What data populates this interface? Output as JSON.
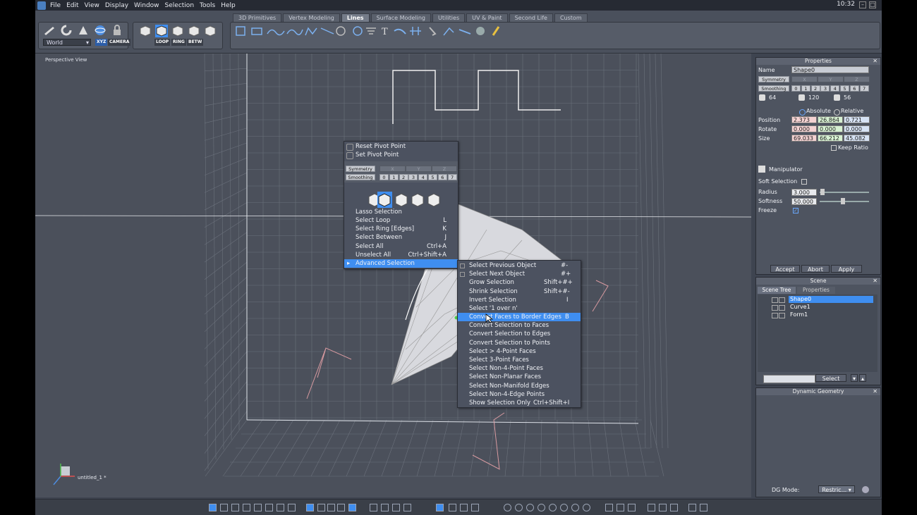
{
  "menubar": {
    "items": [
      "File",
      "Edit",
      "View",
      "Display",
      "Window",
      "Selection",
      "Tools",
      "Help"
    ],
    "clock": "10:32"
  },
  "toolbar": {
    "tabs": [
      "3D Primitives",
      "Vertex Modeling",
      "Lines",
      "Surface Modeling",
      "Utilities",
      "UV & Paint",
      "Second Life",
      "Custom"
    ],
    "active_tab": "Lines",
    "coord_system": "World",
    "xyz_label": "XYZ",
    "camera_label": "CAMERA",
    "loop_label": "LOOP",
    "ring_label": "RING",
    "betw_label": "BETW"
  },
  "viewport": {
    "title": "Perspective View",
    "file_label": "untitled_1 *"
  },
  "context_menu": {
    "pivot_items": [
      "Reset Pivot Point",
      "Set Pivot Point"
    ],
    "symmetry_label": "Symmetry",
    "smoothing_label": "Smoothing",
    "axes": [
      "X",
      "Y",
      "Z"
    ],
    "levels": [
      "0",
      "1",
      "2",
      "3",
      "4",
      "5",
      "6",
      "7"
    ],
    "items": [
      {
        "label": "Lasso Selection",
        "shortcut": ""
      },
      {
        "label": "Select Loop",
        "shortcut": "L"
      },
      {
        "label": "Select Ring [Edges]",
        "shortcut": "K"
      },
      {
        "label": "Select Between",
        "shortcut": "J"
      },
      {
        "label": "Select All",
        "shortcut": "Ctrl+A"
      },
      {
        "label": "Unselect All",
        "shortcut": "Ctrl+Shift+A"
      },
      {
        "label": "Advanced Selection",
        "shortcut": ""
      }
    ]
  },
  "submenu": {
    "items": [
      {
        "label": "Select Previous Object",
        "shortcut": "#-"
      },
      {
        "label": "Select Next Object",
        "shortcut": "#+"
      },
      {
        "label": "Grow Selection",
        "shortcut": "Shift+#+"
      },
      {
        "label": "Shrink Selection",
        "shortcut": "Shift+#-"
      },
      {
        "label": "Invert Selection",
        "shortcut": "I"
      },
      {
        "label": "Select '1 over n'",
        "shortcut": ""
      },
      {
        "label": "Convert Faces to Border Edges",
        "shortcut": "B"
      },
      {
        "label": "Convert Selection to Faces",
        "shortcut": ""
      },
      {
        "label": "Convert Selection to Edges",
        "shortcut": ""
      },
      {
        "label": "Convert Selection to Points",
        "shortcut": ""
      },
      {
        "label": "Select > 4-Point Faces",
        "shortcut": ""
      },
      {
        "label": "Select 3-Point Faces",
        "shortcut": ""
      },
      {
        "label": "Select Non-4-Point Faces",
        "shortcut": ""
      },
      {
        "label": "Select Non-Planar Faces",
        "shortcut": ""
      },
      {
        "label": "Select Non-Manifold Edges",
        "shortcut": ""
      },
      {
        "label": "Select Non-4-Edge Points",
        "shortcut": ""
      },
      {
        "label": "Show Selection Only",
        "shortcut": "Ctrl+Shift+I"
      }
    ]
  },
  "properties": {
    "title": "Properties",
    "name_label": "Name",
    "name_value": "Shape0",
    "symmetry_label": "Symmetry",
    "smoothing_label": "Smoothing",
    "stats": [
      "64",
      "120",
      "56"
    ],
    "absolute_label": "Absolute",
    "relative_label": "Relative",
    "position_label": "Position",
    "rotate_label": "Rotate",
    "size_label": "Size",
    "position": [
      "2.373",
      "26.864",
      "0.721"
    ],
    "rotate": [
      "0.000",
      "0.000",
      "0.000"
    ],
    "size": [
      "69.033",
      "66.212",
      "45.082"
    ],
    "keep_ratio_label": "Keep Ratio",
    "manipulator_label": "Manipulator",
    "soft_selection_label": "Soft Selection",
    "radius_label": "Radius",
    "radius_value": "3.000",
    "softness_label": "Softness",
    "softness_value": "50.000",
    "freeze_label": "Freeze",
    "accept_label": "Accept",
    "abort_label": "Abort",
    "apply_label": "Apply"
  },
  "scene": {
    "title": "Scene",
    "tab_tree": "Scene Tree",
    "tab_props": "Properties",
    "items": [
      "Shape0",
      "Curve1",
      "Form1"
    ],
    "select_label": "Select"
  },
  "dynamic_geometry": {
    "title": "Dynamic Geometry",
    "dg_mode_label": "DG Mode:",
    "dg_mode_value": "Restric..."
  },
  "colors": {
    "highlight": "#3f8ef0",
    "panel": "#4e5460",
    "viewport": "#4b505b"
  }
}
